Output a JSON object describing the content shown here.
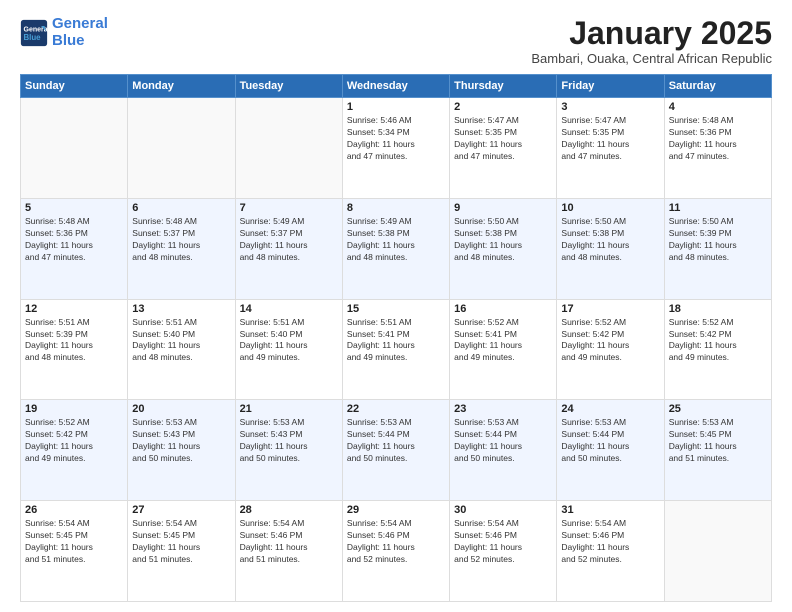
{
  "logo": {
    "line1": "General",
    "line2": "Blue"
  },
  "header": {
    "month_year": "January 2025",
    "location": "Bambari, Ouaka, Central African Republic"
  },
  "weekdays": [
    "Sunday",
    "Monday",
    "Tuesday",
    "Wednesday",
    "Thursday",
    "Friday",
    "Saturday"
  ],
  "weeks": [
    [
      {
        "day": "",
        "info": ""
      },
      {
        "day": "",
        "info": ""
      },
      {
        "day": "",
        "info": ""
      },
      {
        "day": "1",
        "info": "Sunrise: 5:46 AM\nSunset: 5:34 PM\nDaylight: 11 hours\nand 47 minutes."
      },
      {
        "day": "2",
        "info": "Sunrise: 5:47 AM\nSunset: 5:35 PM\nDaylight: 11 hours\nand 47 minutes."
      },
      {
        "day": "3",
        "info": "Sunrise: 5:47 AM\nSunset: 5:35 PM\nDaylight: 11 hours\nand 47 minutes."
      },
      {
        "day": "4",
        "info": "Sunrise: 5:48 AM\nSunset: 5:36 PM\nDaylight: 11 hours\nand 47 minutes."
      }
    ],
    [
      {
        "day": "5",
        "info": "Sunrise: 5:48 AM\nSunset: 5:36 PM\nDaylight: 11 hours\nand 47 minutes."
      },
      {
        "day": "6",
        "info": "Sunrise: 5:48 AM\nSunset: 5:37 PM\nDaylight: 11 hours\nand 48 minutes."
      },
      {
        "day": "7",
        "info": "Sunrise: 5:49 AM\nSunset: 5:37 PM\nDaylight: 11 hours\nand 48 minutes."
      },
      {
        "day": "8",
        "info": "Sunrise: 5:49 AM\nSunset: 5:38 PM\nDaylight: 11 hours\nand 48 minutes."
      },
      {
        "day": "9",
        "info": "Sunrise: 5:50 AM\nSunset: 5:38 PM\nDaylight: 11 hours\nand 48 minutes."
      },
      {
        "day": "10",
        "info": "Sunrise: 5:50 AM\nSunset: 5:38 PM\nDaylight: 11 hours\nand 48 minutes."
      },
      {
        "day": "11",
        "info": "Sunrise: 5:50 AM\nSunset: 5:39 PM\nDaylight: 11 hours\nand 48 minutes."
      }
    ],
    [
      {
        "day": "12",
        "info": "Sunrise: 5:51 AM\nSunset: 5:39 PM\nDaylight: 11 hours\nand 48 minutes."
      },
      {
        "day": "13",
        "info": "Sunrise: 5:51 AM\nSunset: 5:40 PM\nDaylight: 11 hours\nand 48 minutes."
      },
      {
        "day": "14",
        "info": "Sunrise: 5:51 AM\nSunset: 5:40 PM\nDaylight: 11 hours\nand 49 minutes."
      },
      {
        "day": "15",
        "info": "Sunrise: 5:51 AM\nSunset: 5:41 PM\nDaylight: 11 hours\nand 49 minutes."
      },
      {
        "day": "16",
        "info": "Sunrise: 5:52 AM\nSunset: 5:41 PM\nDaylight: 11 hours\nand 49 minutes."
      },
      {
        "day": "17",
        "info": "Sunrise: 5:52 AM\nSunset: 5:42 PM\nDaylight: 11 hours\nand 49 minutes."
      },
      {
        "day": "18",
        "info": "Sunrise: 5:52 AM\nSunset: 5:42 PM\nDaylight: 11 hours\nand 49 minutes."
      }
    ],
    [
      {
        "day": "19",
        "info": "Sunrise: 5:52 AM\nSunset: 5:42 PM\nDaylight: 11 hours\nand 49 minutes."
      },
      {
        "day": "20",
        "info": "Sunrise: 5:53 AM\nSunset: 5:43 PM\nDaylight: 11 hours\nand 50 minutes."
      },
      {
        "day": "21",
        "info": "Sunrise: 5:53 AM\nSunset: 5:43 PM\nDaylight: 11 hours\nand 50 minutes."
      },
      {
        "day": "22",
        "info": "Sunrise: 5:53 AM\nSunset: 5:44 PM\nDaylight: 11 hours\nand 50 minutes."
      },
      {
        "day": "23",
        "info": "Sunrise: 5:53 AM\nSunset: 5:44 PM\nDaylight: 11 hours\nand 50 minutes."
      },
      {
        "day": "24",
        "info": "Sunrise: 5:53 AM\nSunset: 5:44 PM\nDaylight: 11 hours\nand 50 minutes."
      },
      {
        "day": "25",
        "info": "Sunrise: 5:53 AM\nSunset: 5:45 PM\nDaylight: 11 hours\nand 51 minutes."
      }
    ],
    [
      {
        "day": "26",
        "info": "Sunrise: 5:54 AM\nSunset: 5:45 PM\nDaylight: 11 hours\nand 51 minutes."
      },
      {
        "day": "27",
        "info": "Sunrise: 5:54 AM\nSunset: 5:45 PM\nDaylight: 11 hours\nand 51 minutes."
      },
      {
        "day": "28",
        "info": "Sunrise: 5:54 AM\nSunset: 5:46 PM\nDaylight: 11 hours\nand 51 minutes."
      },
      {
        "day": "29",
        "info": "Sunrise: 5:54 AM\nSunset: 5:46 PM\nDaylight: 11 hours\nand 52 minutes."
      },
      {
        "day": "30",
        "info": "Sunrise: 5:54 AM\nSunset: 5:46 PM\nDaylight: 11 hours\nand 52 minutes."
      },
      {
        "day": "31",
        "info": "Sunrise: 5:54 AM\nSunset: 5:46 PM\nDaylight: 11 hours\nand 52 minutes."
      },
      {
        "day": "",
        "info": ""
      }
    ]
  ]
}
